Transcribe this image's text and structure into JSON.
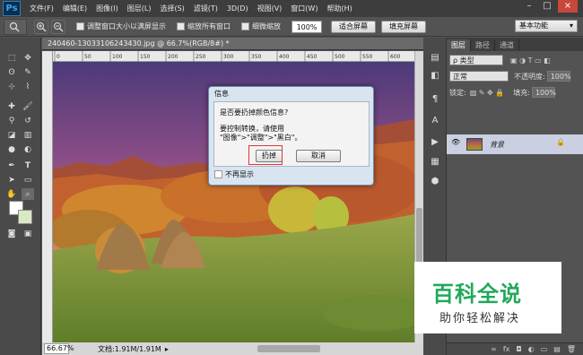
{
  "app": {
    "logo": "Ps",
    "menu": [
      "文件(F)",
      "编辑(E)",
      "图像(I)",
      "图层(L)",
      "选择(S)",
      "滤镜(T)",
      "3D(D)",
      "视图(V)",
      "窗口(W)",
      "帮助(H)"
    ],
    "window_buttons": [
      "–",
      "□",
      "×"
    ]
  },
  "options_bar": {
    "resize_windows_label": "调整窗口大小以满屏显示",
    "zoom_all_windows_label": "缩放所有窗口",
    "scrubby_zoom_label": "细微缩放",
    "zoom_value": "100%",
    "fit_screen_label": "适合屏幕",
    "fill_screen_label": "填充屏幕",
    "workspace": "基本功能"
  },
  "document": {
    "tab_title": "240460-13033106243430.jpg @ 66.7%(RGB/8#) *",
    "ruler_ticks": [
      "0",
      "50",
      "100",
      "150",
      "200",
      "250",
      "300",
      "350",
      "400",
      "450",
      "500",
      "550",
      "600"
    ],
    "zoom": "66.67%",
    "doc_info": "文档:1.91M/1.91M"
  },
  "dialog": {
    "title": "信息",
    "question": "是否要扔掉颜色信息?",
    "hint1": "要控制转换，请使用",
    "hint2": "\"图像\">\"调整\">\"黑白\"。",
    "discard_label": "扔掉",
    "cancel_label": "取消",
    "dont_show_label": "不再显示"
  },
  "layers_panel": {
    "tabs": [
      "图层",
      "路径",
      "通道"
    ],
    "kind_filter": "ρ 类型",
    "blend_mode": "正常",
    "opacity_label": "不透明度:",
    "opacity_value": "100%",
    "lock_label": "锁定:",
    "fill_label": "填充:",
    "fill_value": "100%",
    "layer_name": "背景",
    "bottom_icons": [
      "∞",
      "fx",
      "◘",
      "◐",
      "▭",
      "▤",
      "🗑"
    ]
  },
  "watermark": {
    "big": "百科全说",
    "small": "助你轻松解决"
  },
  "colors": {
    "accent": "#2e7dbf",
    "selected_layer": "#cad0e1",
    "highlight_box": "#e03636",
    "watermark_green": "#21a85a"
  }
}
